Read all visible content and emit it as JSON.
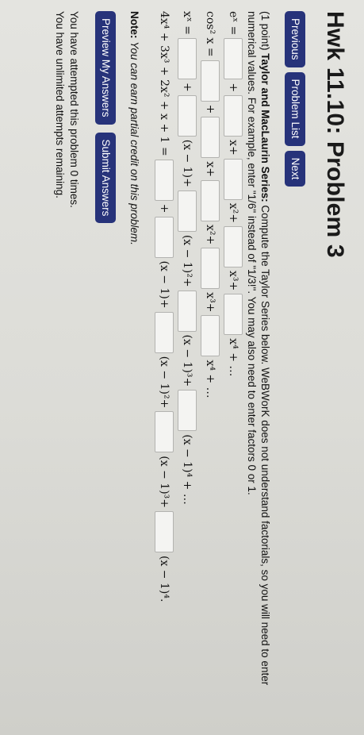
{
  "header": {
    "title": "Hwk 11.10: Problem 3"
  },
  "nav": {
    "previous": "Previous",
    "problem_list": "Problem List",
    "next": "Next"
  },
  "problem": {
    "points": "(1 point)",
    "heading": "Taylor and MacLaurin Series:",
    "instructions": "Compute the Taylor Series below. WeBWorK does not understand factorials, so you will need to enter numerical values. For example, enter \"1/6\" instead of \"1/3!\". You may also need to enter factors 0 or 1.",
    "rows": [
      {
        "lhs": "eˣ =",
        "terms": [
          "+",
          "x+",
          "x²+",
          "x³+",
          "x⁴ + …"
        ]
      },
      {
        "lhs": "cos² x =",
        "terms": [
          "+",
          "x+",
          "x²+",
          "x³+",
          "x⁴ + …"
        ]
      },
      {
        "lhs": "xˣ =",
        "terms": [
          "+",
          "(x − 1)+",
          "(x − 1)²+",
          "(x − 1)³+",
          "(x − 1)⁴ + …"
        ]
      },
      {
        "lhs": "4x⁴ + 3x³ + 2x² + x + 1 =",
        "terms": [
          "+",
          "(x − 1)+",
          "(x − 1)²+",
          "(x − 1)³+",
          "(x − 1)⁴."
        ]
      }
    ]
  },
  "note": {
    "label": "Note:",
    "text": "You can earn partial credit on this problem."
  },
  "actions": {
    "preview": "Preview My Answers",
    "submit": "Submit Answers"
  },
  "status": {
    "attempts": "You have attempted this problem 0 times.",
    "remaining": "You have unlimited attempts remaining."
  }
}
